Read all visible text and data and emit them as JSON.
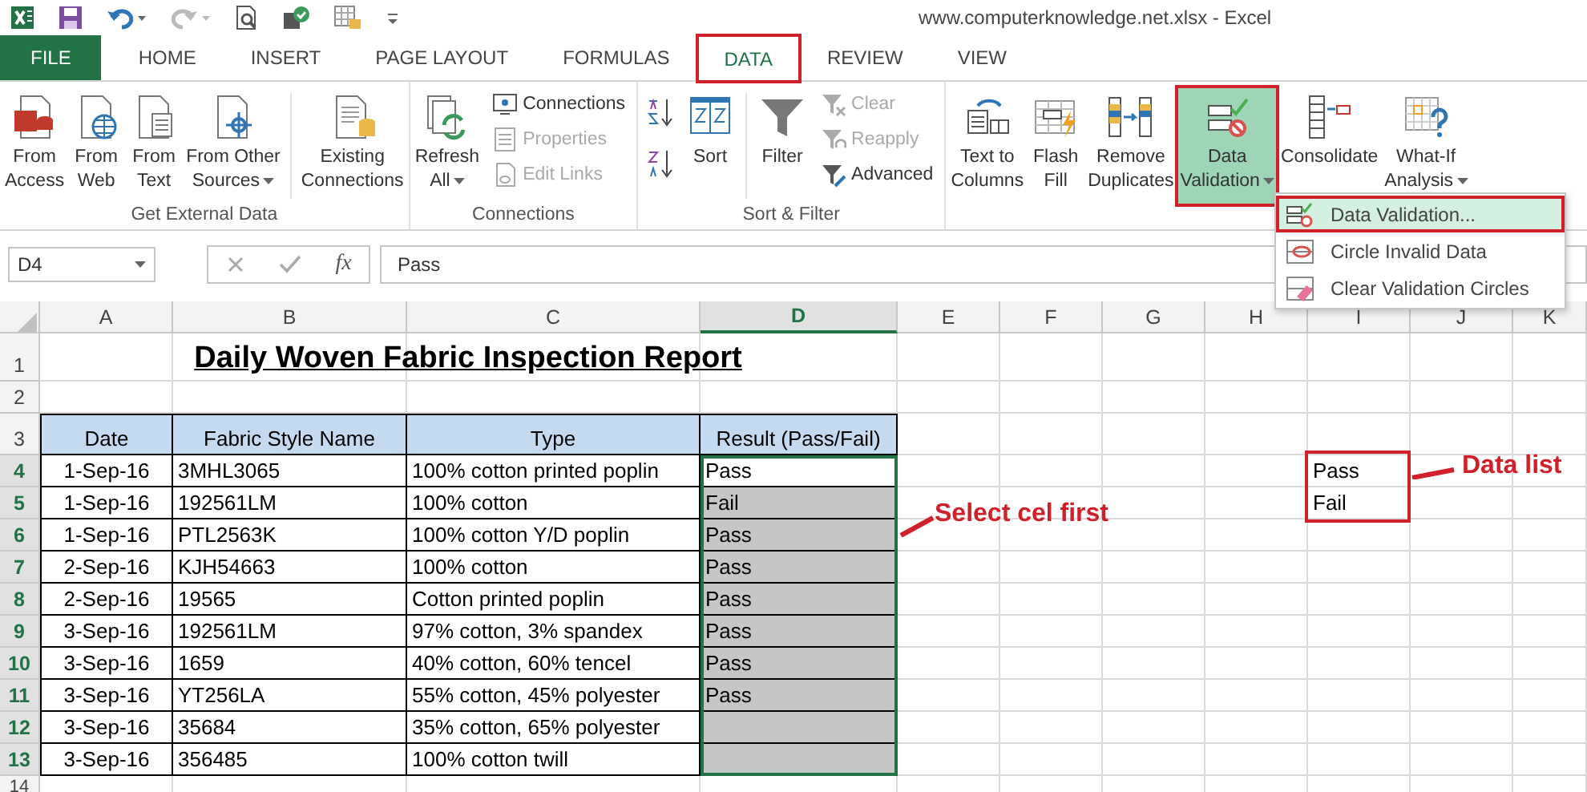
{
  "window": {
    "title": "www.computerknowledge.net.xlsx - Excel"
  },
  "tabs": [
    {
      "label": "FILE",
      "kind": "backstage",
      "selected": false,
      "highlighted": false
    },
    {
      "label": "HOME",
      "kind": "tab",
      "selected": false,
      "highlighted": false
    },
    {
      "label": "INSERT",
      "kind": "tab",
      "selected": false,
      "highlighted": false
    },
    {
      "label": "PAGE LAYOUT",
      "kind": "tab",
      "selected": false,
      "highlighted": false
    },
    {
      "label": "FORMULAS",
      "kind": "tab",
      "selected": false,
      "highlighted": false
    },
    {
      "label": "DATA",
      "kind": "tab",
      "selected": true,
      "highlighted": true
    },
    {
      "label": "REVIEW",
      "kind": "tab",
      "selected": false,
      "highlighted": false
    },
    {
      "label": "VIEW",
      "kind": "tab",
      "selected": false,
      "highlighted": false
    }
  ],
  "ribbon": {
    "groups": [
      {
        "label": "Get External Data",
        "items": [
          {
            "kind": "large",
            "lines": [
              "From",
              "Access"
            ],
            "dropdown": false,
            "disabled": false,
            "pressed": false,
            "highlighted": false
          },
          {
            "kind": "large",
            "lines": [
              "From",
              "Web"
            ],
            "dropdown": false,
            "disabled": false,
            "pressed": false,
            "highlighted": false
          },
          {
            "kind": "large",
            "lines": [
              "From",
              "Text"
            ],
            "dropdown": false,
            "disabled": false,
            "pressed": false,
            "highlighted": false
          },
          {
            "kind": "large",
            "lines": [
              "From Other",
              "Sources"
            ],
            "dropdown": true,
            "disabled": false,
            "pressed": false,
            "highlighted": false
          },
          {
            "kind": "separator"
          },
          {
            "kind": "large",
            "lines": [
              "Existing",
              "Connections"
            ],
            "dropdown": false,
            "disabled": false,
            "pressed": false,
            "highlighted": false
          }
        ]
      },
      {
        "label": "Connections",
        "items": [
          {
            "kind": "large",
            "lines": [
              "Refresh",
              "All"
            ],
            "dropdown": true,
            "disabled": false,
            "pressed": false,
            "highlighted": false
          },
          {
            "kind": "stack",
            "buttons": [
              {
                "label": "Connections",
                "disabled": false
              },
              {
                "label": "Properties",
                "disabled": true
              },
              {
                "label": "Edit Links",
                "disabled": true
              }
            ]
          }
        ]
      },
      {
        "label": "Sort & Filter",
        "items": [
          {
            "kind": "sort-icons"
          },
          {
            "kind": "large",
            "lines": [
              "Sort"
            ],
            "dropdown": false,
            "disabled": false,
            "pressed": false,
            "highlighted": false
          },
          {
            "kind": "separator"
          },
          {
            "kind": "large",
            "lines": [
              "Filter"
            ],
            "dropdown": false,
            "disabled": false,
            "pressed": false,
            "highlighted": false
          },
          {
            "kind": "stack",
            "buttons": [
              {
                "label": "Clear",
                "disabled": true
              },
              {
                "label": "Reapply",
                "disabled": true
              },
              {
                "label": "Advanced",
                "disabled": false
              }
            ]
          }
        ]
      },
      {
        "items": [
          {
            "kind": "large",
            "lines": [
              "Text to",
              "Columns"
            ],
            "dropdown": false,
            "disabled": false,
            "pressed": false,
            "highlighted": false
          },
          {
            "kind": "large",
            "lines": [
              "Flash",
              "Fill"
            ],
            "dropdown": false,
            "disabled": false,
            "pressed": false,
            "highlighted": false
          },
          {
            "kind": "large",
            "lines": [
              "Remove",
              "Duplicates"
            ],
            "dropdown": false,
            "disabled": false,
            "pressed": false,
            "highlighted": false
          },
          {
            "kind": "large",
            "lines": [
              "Data",
              "Validation"
            ],
            "dropdown": true,
            "disabled": false,
            "pressed": true,
            "highlighted": true
          },
          {
            "kind": "large",
            "lines": [
              "Consolidate"
            ],
            "dropdown": false,
            "disabled": false,
            "pressed": false,
            "highlighted": false
          },
          {
            "kind": "large",
            "lines": [
              "What-If",
              "Analysis"
            ],
            "dropdown": true,
            "disabled": false,
            "pressed": false,
            "highlighted": false
          }
        ]
      }
    ]
  },
  "dropdown_menu": {
    "items": [
      {
        "label": "Data Validation...",
        "hovered": true,
        "highlighted": true
      },
      {
        "label": "Circle Invalid Data",
        "hovered": false,
        "highlighted": false
      },
      {
        "label": "Clear Validation Circles",
        "hovered": false,
        "highlighted": false
      }
    ]
  },
  "formula_bar": {
    "name_box": "D4",
    "function_label": "fx",
    "value": "Pass"
  },
  "sheet": {
    "columns": [
      {
        "label": "A",
        "selected": false
      },
      {
        "label": "B",
        "selected": false
      },
      {
        "label": "C",
        "selected": false
      },
      {
        "label": "D",
        "selected": true
      },
      {
        "label": "E",
        "selected": false
      },
      {
        "label": "F",
        "selected": false
      },
      {
        "label": "G",
        "selected": false
      },
      {
        "label": "H",
        "selected": false
      },
      {
        "label": "I",
        "selected": false
      },
      {
        "label": "J",
        "selected": false
      },
      {
        "label": "K",
        "selected": false
      }
    ],
    "title_row": {
      "number": "1",
      "title": "Daily Woven Fabric Inspection Report"
    },
    "blank_row": {
      "number": "2"
    },
    "header_row": {
      "number": "3",
      "cells": [
        "Date",
        "Fabric Style Name",
        "Type",
        "Result (Pass/Fail)"
      ]
    },
    "rows": [
      {
        "number": "4",
        "selected": true,
        "active": true,
        "cells": [
          "1-Sep-16",
          "3MHL3065",
          "100% cotton printed poplin",
          "Pass"
        ]
      },
      {
        "number": "5",
        "selected": true,
        "active": false,
        "cells": [
          "1-Sep-16",
          "192561LM",
          "100% cotton",
          "Fail"
        ]
      },
      {
        "number": "6",
        "selected": true,
        "active": false,
        "cells": [
          "1-Sep-16",
          "PTL2563K",
          "100% cotton Y/D poplin",
          "Pass"
        ]
      },
      {
        "number": "7",
        "selected": true,
        "active": false,
        "cells": [
          "2-Sep-16",
          "KJH54663",
          "100% cotton",
          "Pass"
        ]
      },
      {
        "number": "8",
        "selected": true,
        "active": false,
        "cells": [
          "2-Sep-16",
          "19565",
          "Cotton printed poplin",
          "Pass"
        ]
      },
      {
        "number": "9",
        "selected": true,
        "active": false,
        "cells": [
          "3-Sep-16",
          "192561LM",
          "97% cotton, 3% spandex",
          "Pass"
        ]
      },
      {
        "number": "10",
        "selected": true,
        "active": false,
        "cells": [
          "3-Sep-16",
          "1659",
          "40% cotton, 60% tencel",
          "Pass"
        ]
      },
      {
        "number": "11",
        "selected": true,
        "active": false,
        "cells": [
          "3-Sep-16",
          "YT256LA",
          "55% cotton, 45% polyester",
          "Pass"
        ]
      },
      {
        "number": "12",
        "selected": true,
        "active": false,
        "cells": [
          "3-Sep-16",
          "35684",
          "35% cotton, 65% polyester",
          ""
        ]
      },
      {
        "number": "13",
        "selected": true,
        "active": false,
        "cells": [
          "3-Sep-16",
          "356485",
          "100% cotton twill",
          ""
        ]
      }
    ],
    "last_row": {
      "number": "14"
    },
    "data_list": [
      "Pass",
      "Fail"
    ]
  },
  "annotations": [
    {
      "text": "Select cel first"
    },
    {
      "text": "Data list"
    }
  ]
}
